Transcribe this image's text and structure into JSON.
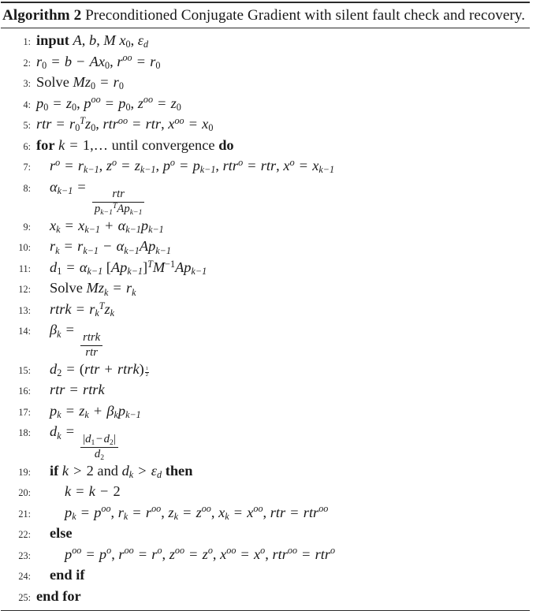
{
  "document_type": "algorithm-pseudocode-float",
  "caption": {
    "label": "Algorithm 2",
    "text": "Preconditioned Conjugate Gradient with silent fault check and recovery."
  },
  "colors": {
    "text": "#1a1a1a",
    "rule": "#2b2b2b",
    "background": "#ffffff"
  },
  "lines": [
    {
      "number": "1",
      "indent": 0,
      "text": "input A, b, M x_0, ε_d"
    },
    {
      "number": "2",
      "indent": 0,
      "text": "r_0 = b − Ax_0, r^{oo} = r_0"
    },
    {
      "number": "3",
      "indent": 0,
      "text": "Solve Mz_0 = r_0"
    },
    {
      "number": "4",
      "indent": 0,
      "text": "p_0 = z_0, p^{oo} = p_0, z^{oo} = z_0"
    },
    {
      "number": "5",
      "indent": 0,
      "text": "rtr = r_0^T z_0, rtr^{oo} = rtr, x^{oo} = x_0"
    },
    {
      "number": "6",
      "indent": 0,
      "text": "for k = 1, ... until convergence do"
    },
    {
      "number": "7",
      "indent": 1,
      "text": "r^o = r_{k−1}, z^o = z_{k−1}, p^o = p_{k−1}, rtr^o = rtr, x^o = x_{k−1}"
    },
    {
      "number": "8",
      "indent": 1,
      "text": "α_{k−1} = rtr / (p_{k−1}^T Ap_{k−1})"
    },
    {
      "number": "9",
      "indent": 1,
      "text": "x_k = x_{k−1} + α_{k−1} p_{k−1}"
    },
    {
      "number": "10",
      "indent": 1,
      "text": "r_k = r_{k−1} − α_{k−1} Ap_{k−1}"
    },
    {
      "number": "11",
      "indent": 1,
      "text": "d_1 = α_{k−1} [Ap_{k−1}]^T M^{−1} Ap_{k−1}"
    },
    {
      "number": "12",
      "indent": 1,
      "text": "Solve Mz_k = r_k"
    },
    {
      "number": "13",
      "indent": 1,
      "text": "rtrk = r_k^T z_k"
    },
    {
      "number": "14",
      "indent": 1,
      "text": "β_k = rtrk / rtr"
    },
    {
      "number": "15",
      "indent": 1,
      "text": "d_2 = (rtr + rtrk)^{1/2}"
    },
    {
      "number": "16",
      "indent": 1,
      "text": "rtr = rtrk"
    },
    {
      "number": "17",
      "indent": 1,
      "text": "p_k = z_k + β_k p_{k−1}"
    },
    {
      "number": "18",
      "indent": 1,
      "text": "d_k = |d_1 − d_2| / d_2"
    },
    {
      "number": "19",
      "indent": 1,
      "text": "if k > 2 and d_k > ε_d then"
    },
    {
      "number": "20",
      "indent": 2,
      "text": "k = k − 2"
    },
    {
      "number": "21",
      "indent": 2,
      "text": "p_k = p^{oo}, r_k = r^{oo}, z_k = z^{oo}, x_k = x^{oo}, rtr = rtr^{oo}"
    },
    {
      "number": "22",
      "indent": 1,
      "text": "else"
    },
    {
      "number": "23",
      "indent": 2,
      "text": "p^{oo} = p^o, r^{oo} = r^o, z^{oo} = z^o, x^{oo} = x^o, rtr^{oo} = rtr^o"
    },
    {
      "number": "24",
      "indent": 1,
      "text": "end if"
    },
    {
      "number": "25",
      "indent": 0,
      "text": "end for"
    }
  ],
  "keywords": {
    "input": "input",
    "solve": "Solve",
    "for": "for",
    "do": "do",
    "until_convergence": "until convergence",
    "if": "if",
    "and": "and",
    "then": "then",
    "else": "else",
    "end_if": "end if",
    "end_for": "end for"
  },
  "symbols": {
    "A": "A",
    "b": "b",
    "M": "M",
    "x": "x",
    "r": "r",
    "z": "z",
    "p": "p",
    "k": "k",
    "alpha": "α",
    "beta": "β",
    "epsilon": "ε",
    "d": "d",
    "rtr": "rtr",
    "rtrk": "rtrk",
    "T": "T",
    "o": "o",
    "oo": "oo",
    "eq": "=",
    "plus": "+",
    "minus": "−",
    "gt": ">",
    "comma": ",",
    "zero": "0",
    "one": "1",
    "two": "2",
    "ellipsis": "..."
  }
}
